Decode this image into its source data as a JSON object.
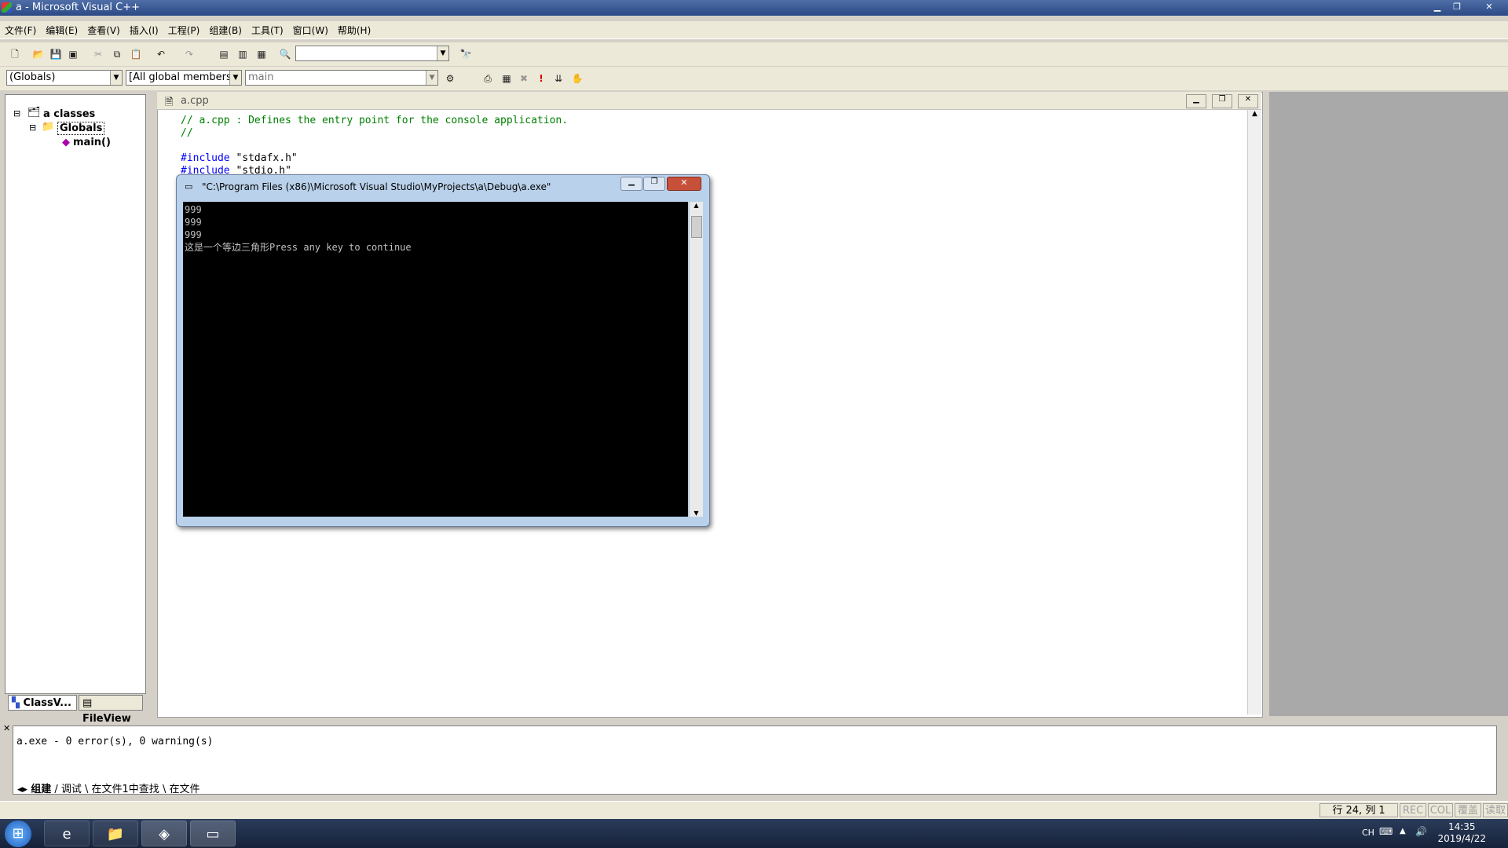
{
  "window": {
    "title": "a - Microsoft Visual C++"
  },
  "menu": [
    "文件(F)",
    "编辑(E)",
    "查看(V)",
    "插入(I)",
    "工程(P)",
    "组建(B)",
    "工具(T)",
    "窗口(W)",
    "帮助(H)"
  ],
  "toolbar": {
    "scope_combo": "(Globals)",
    "members_combo": "[All global members",
    "function_combo": "main"
  },
  "workspace": {
    "root": "a classes",
    "folder": "Globals",
    "item": "main()",
    "tabs": [
      "ClassV...",
      "FileView"
    ]
  },
  "editor": {
    "tab_title": "a.cpp",
    "lines": [
      "// a.cpp : Defines the entry point for the console application.",
      "//",
      "",
      "#include \"stdafx.h\"",
      "#include \"stdio.h\""
    ]
  },
  "console": {
    "title": "\"C:\\Program Files (x86)\\Microsoft Visual Studio\\MyProjects\\a\\Debug\\a.exe\"",
    "output": "999\n999\n999\n这是一个等边三角形Press any key to continue"
  },
  "output_pane": {
    "message": "a.exe - 0 error(s), 0 warning(s)",
    "tabs": [
      "组建",
      "调试",
      "在文件1中查找",
      "在文件"
    ]
  },
  "statusbar": {
    "position": "行 24, 列 1",
    "rec": "REC",
    "col": "COL",
    "ovr": "覆盖",
    "read": "读取"
  },
  "taskbar": {
    "lang": "CH",
    "time": "14:35",
    "date": "2019/4/22"
  }
}
